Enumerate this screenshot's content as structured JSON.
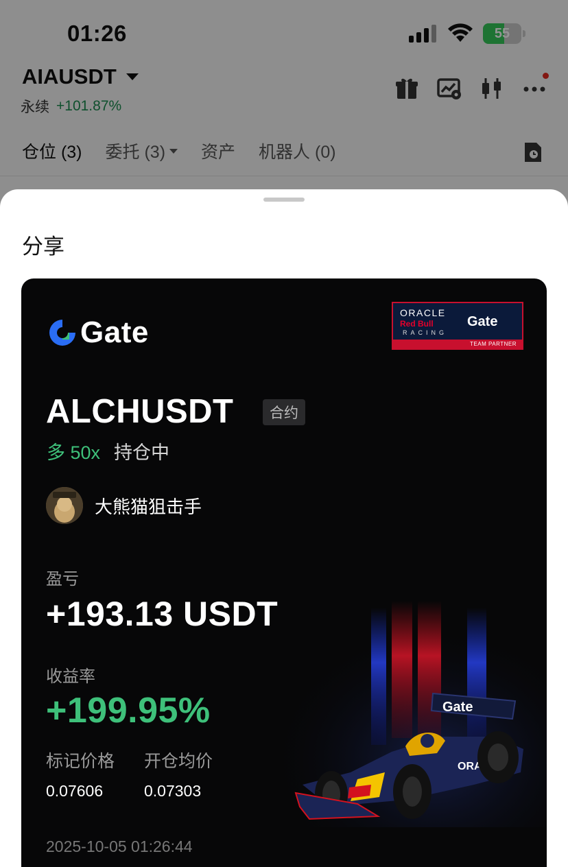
{
  "status_bar": {
    "time": "01:26",
    "battery": "55",
    "battery_level": 0.55
  },
  "header": {
    "pair": "AIAUSDT",
    "contract_type": "永续",
    "change": "+101.87%"
  },
  "tabs": [
    {
      "label": "仓位 (3)",
      "active": true
    },
    {
      "label": "委托 (3)",
      "active": false
    },
    {
      "label": "资产",
      "active": false
    },
    {
      "label": "机器人 (0)",
      "active": false
    }
  ],
  "sheet": {
    "title": "分享"
  },
  "card": {
    "brand": "Gate",
    "partner": {
      "oracle": "ORACLE",
      "redbull": "Red Bull",
      "racing": "RACING",
      "gate": "Gate",
      "team": "TEAM PARTNER"
    },
    "symbol": "ALCHUSDT",
    "badge": "合约",
    "side": "多 50x",
    "status": "持仓中",
    "username": "大熊猫狙击手",
    "pnl_label": "盈亏",
    "pnl_value": "+193.13 USDT",
    "roi_label": "收益率",
    "roi_value": "+199.95%",
    "mark_price_label": "标记价格",
    "mark_price": "0.07606",
    "entry_price_label": "开仓均价",
    "entry_price": "0.07303",
    "timestamp": "2025-10-05 01:26:44",
    "car_sponsor": "Gate",
    "car_text": "ORACLE"
  },
  "colors": {
    "accent_green": "#3ec07a",
    "card_bg": "#070708",
    "brand_blue": "#2a6df4"
  }
}
